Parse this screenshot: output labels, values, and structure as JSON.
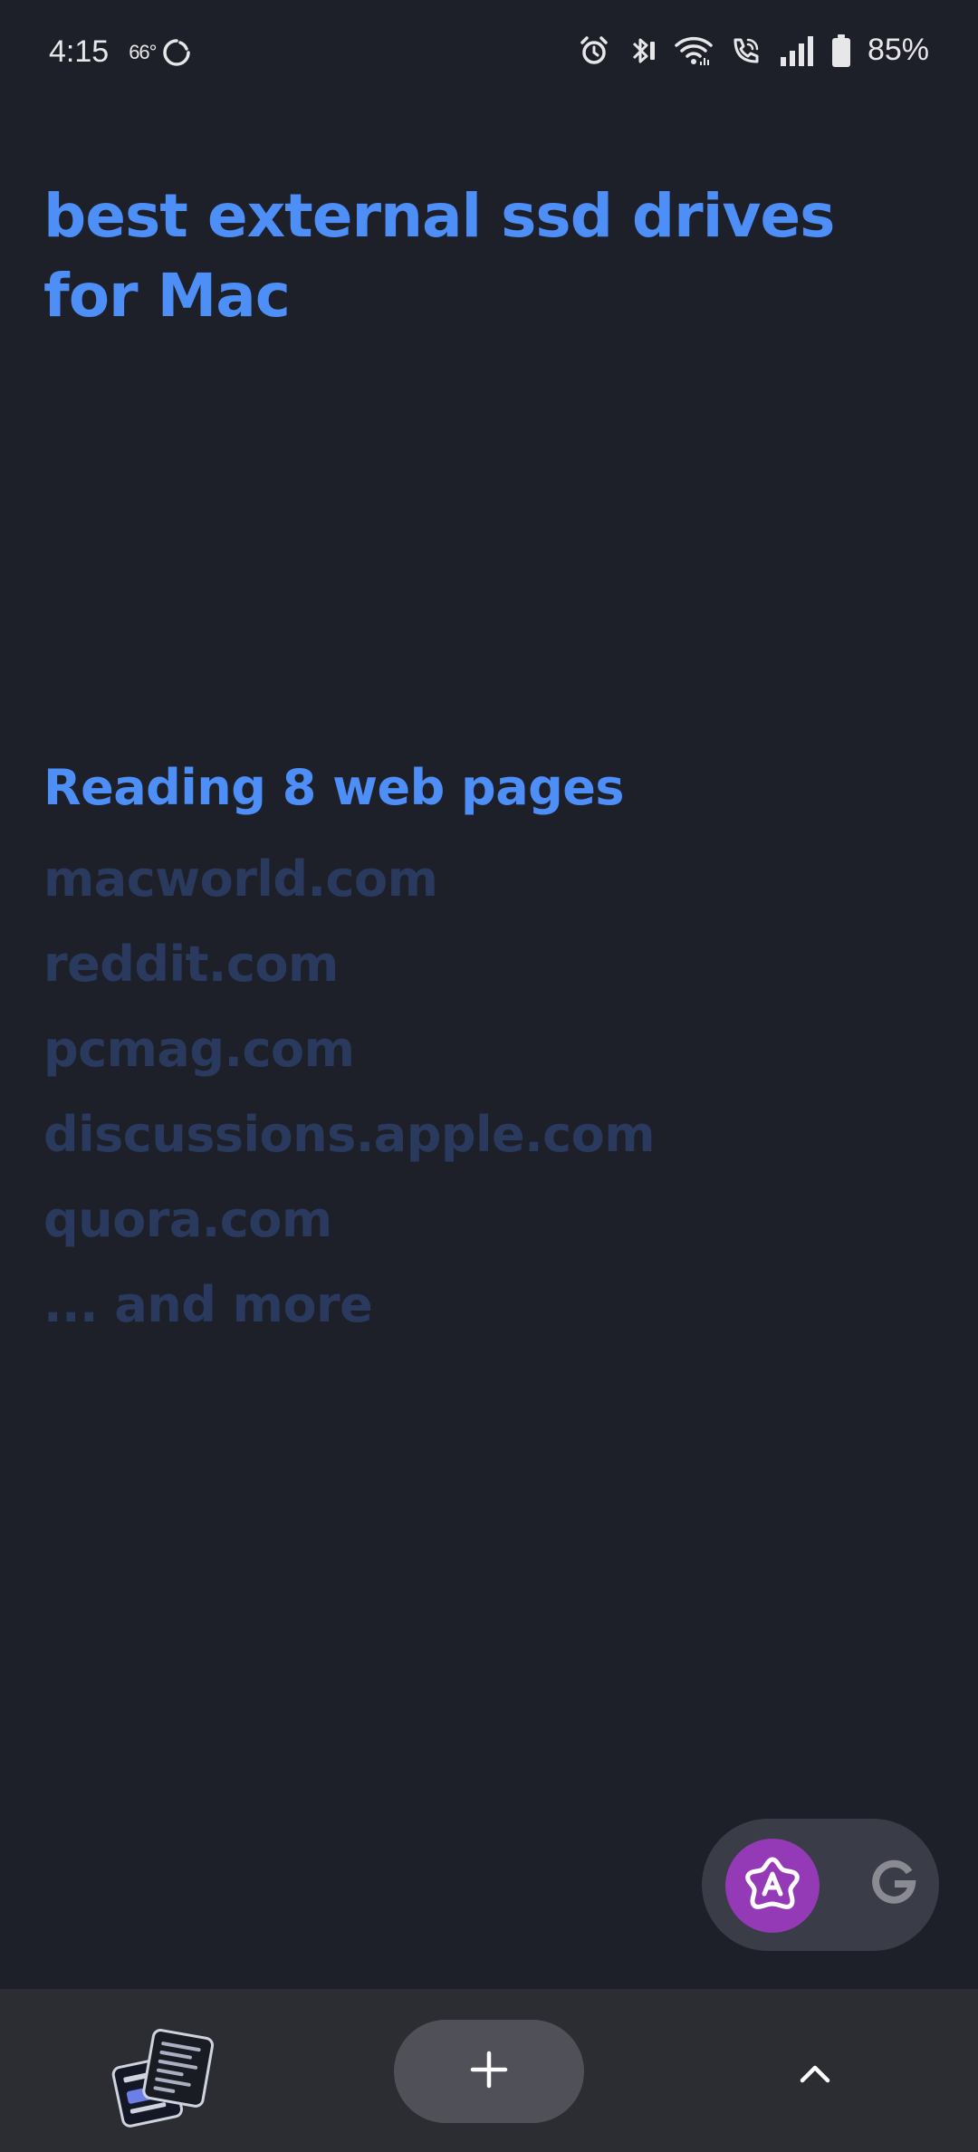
{
  "status_bar": {
    "time": "4:15",
    "temperature": "66°",
    "battery": "85%",
    "icons": [
      "alarm-icon",
      "bluetooth-icon",
      "wifi-icon",
      "wifi-calling-icon",
      "signal-icon",
      "battery-icon"
    ]
  },
  "search": {
    "query": "best external ssd drives for Mac"
  },
  "reading": {
    "heading": "Reading 8 web pages",
    "sources": [
      "macworld.com",
      "reddit.com",
      "pcmag.com",
      "discussions.apple.com",
      "quora.com",
      "... and more"
    ]
  },
  "switcher": {
    "active": "assistant",
    "icons": [
      "assistant-icon",
      "google-icon"
    ]
  },
  "bottom_bar": {
    "icons": [
      "tabs-thumbnail-icon",
      "plus-icon",
      "chevron-up-icon"
    ]
  },
  "colors": {
    "background": "#1e2029",
    "accent": "#4d8ef7",
    "source_text": "#2a3a5e",
    "assistant": "#943ab6",
    "bottom_bar": "#2c2d33"
  }
}
